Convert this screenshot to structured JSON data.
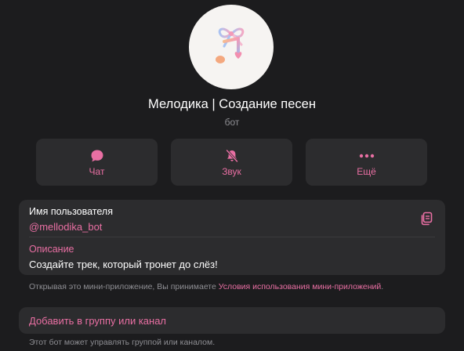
{
  "profile": {
    "title": "Мелодика | Создание песен",
    "subtitle": "бот",
    "avatar_icon": "music-note-bow-icon"
  },
  "actions": [
    {
      "label": "Чат",
      "icon": "chat-bubble-icon"
    },
    {
      "label": "Звук",
      "icon": "bell-muted-icon"
    },
    {
      "label": "Ещё",
      "icon": "more-dots-icon"
    }
  ],
  "info": {
    "username_label": "Имя пользователя",
    "username_value": "@mellodika_bot",
    "description_label": "Описание",
    "description_value": "Создайте трек, который тронет до слёз!",
    "copy_icon": "copy-icon"
  },
  "terms": {
    "text": "Открывая это мини-приложение, Вы принимаете ",
    "link": "Условия использования мини-приложений",
    "end": "."
  },
  "add_group": {
    "label": "Добавить в группу или канал",
    "note": "Этот бот может управлять группой или каналом."
  },
  "colors": {
    "accent": "#e96fa3",
    "background": "#1c1c1e",
    "card": "#2c2c2e",
    "muted_text": "#8e8e93"
  }
}
